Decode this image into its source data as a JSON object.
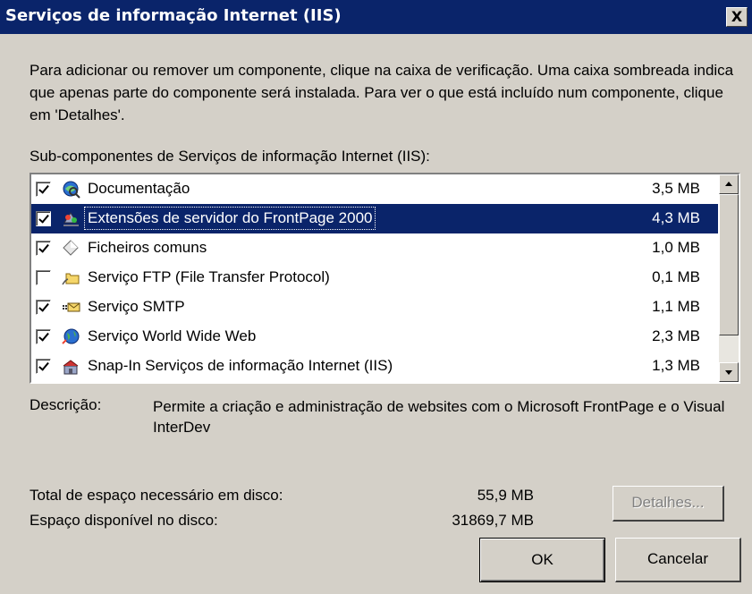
{
  "window": {
    "title": "Serviços de informação Internet (IIS)",
    "close_glyph": "X"
  },
  "intro_text": "Para adicionar ou remover um componente, clique na caixa de verificação. Uma caixa sombreada indica que apenas parte do componente será instalada. Para ver o que está incluído num componente, clique em 'Detalhes'.",
  "list": {
    "caption": "Sub-componentes de Serviços de informação Internet (IIS):",
    "items": [
      {
        "label": "Documentação",
        "size": "3,5 MB",
        "checked": true,
        "selected": false,
        "icon": "documentation-icon"
      },
      {
        "label": "Extensões de servidor do FrontPage 2000",
        "size": "4,3 MB",
        "checked": true,
        "selected": true,
        "icon": "frontpage-extensions-icon"
      },
      {
        "label": "Ficheiros comuns",
        "size": "1,0 MB",
        "checked": true,
        "selected": false,
        "icon": "common-files-icon"
      },
      {
        "label": "Serviço FTP (File Transfer Protocol)",
        "size": "0,1 MB",
        "checked": false,
        "selected": false,
        "icon": "ftp-folder-icon"
      },
      {
        "label": "Serviço SMTP",
        "size": "1,1 MB",
        "checked": true,
        "selected": false,
        "icon": "smtp-mail-icon"
      },
      {
        "label": "Serviço World Wide Web",
        "size": "2,3 MB",
        "checked": true,
        "selected": false,
        "icon": "www-globe-icon"
      },
      {
        "label": "Snap-In Serviços de informação Internet (IIS)",
        "size": "1,3 MB",
        "checked": true,
        "selected": false,
        "icon": "snap-in-icon"
      }
    ]
  },
  "description": {
    "label": "Descrição:",
    "text": "Permite a criação e administração de websites com o Microsoft FrontPage e o Visual InterDev"
  },
  "disk": {
    "required_label": "Total de espaço necessário em disco:",
    "required_value": "55,9 MB",
    "available_label": "Espaço disponível no disco:",
    "available_value": "31869,7 MB"
  },
  "buttons": {
    "details": "Detalhes...",
    "ok": "OK",
    "cancel": "Cancelar"
  },
  "colors": {
    "titlebar": "#0a246a",
    "face": "#d4d0c8",
    "selection": "#0a246a"
  }
}
